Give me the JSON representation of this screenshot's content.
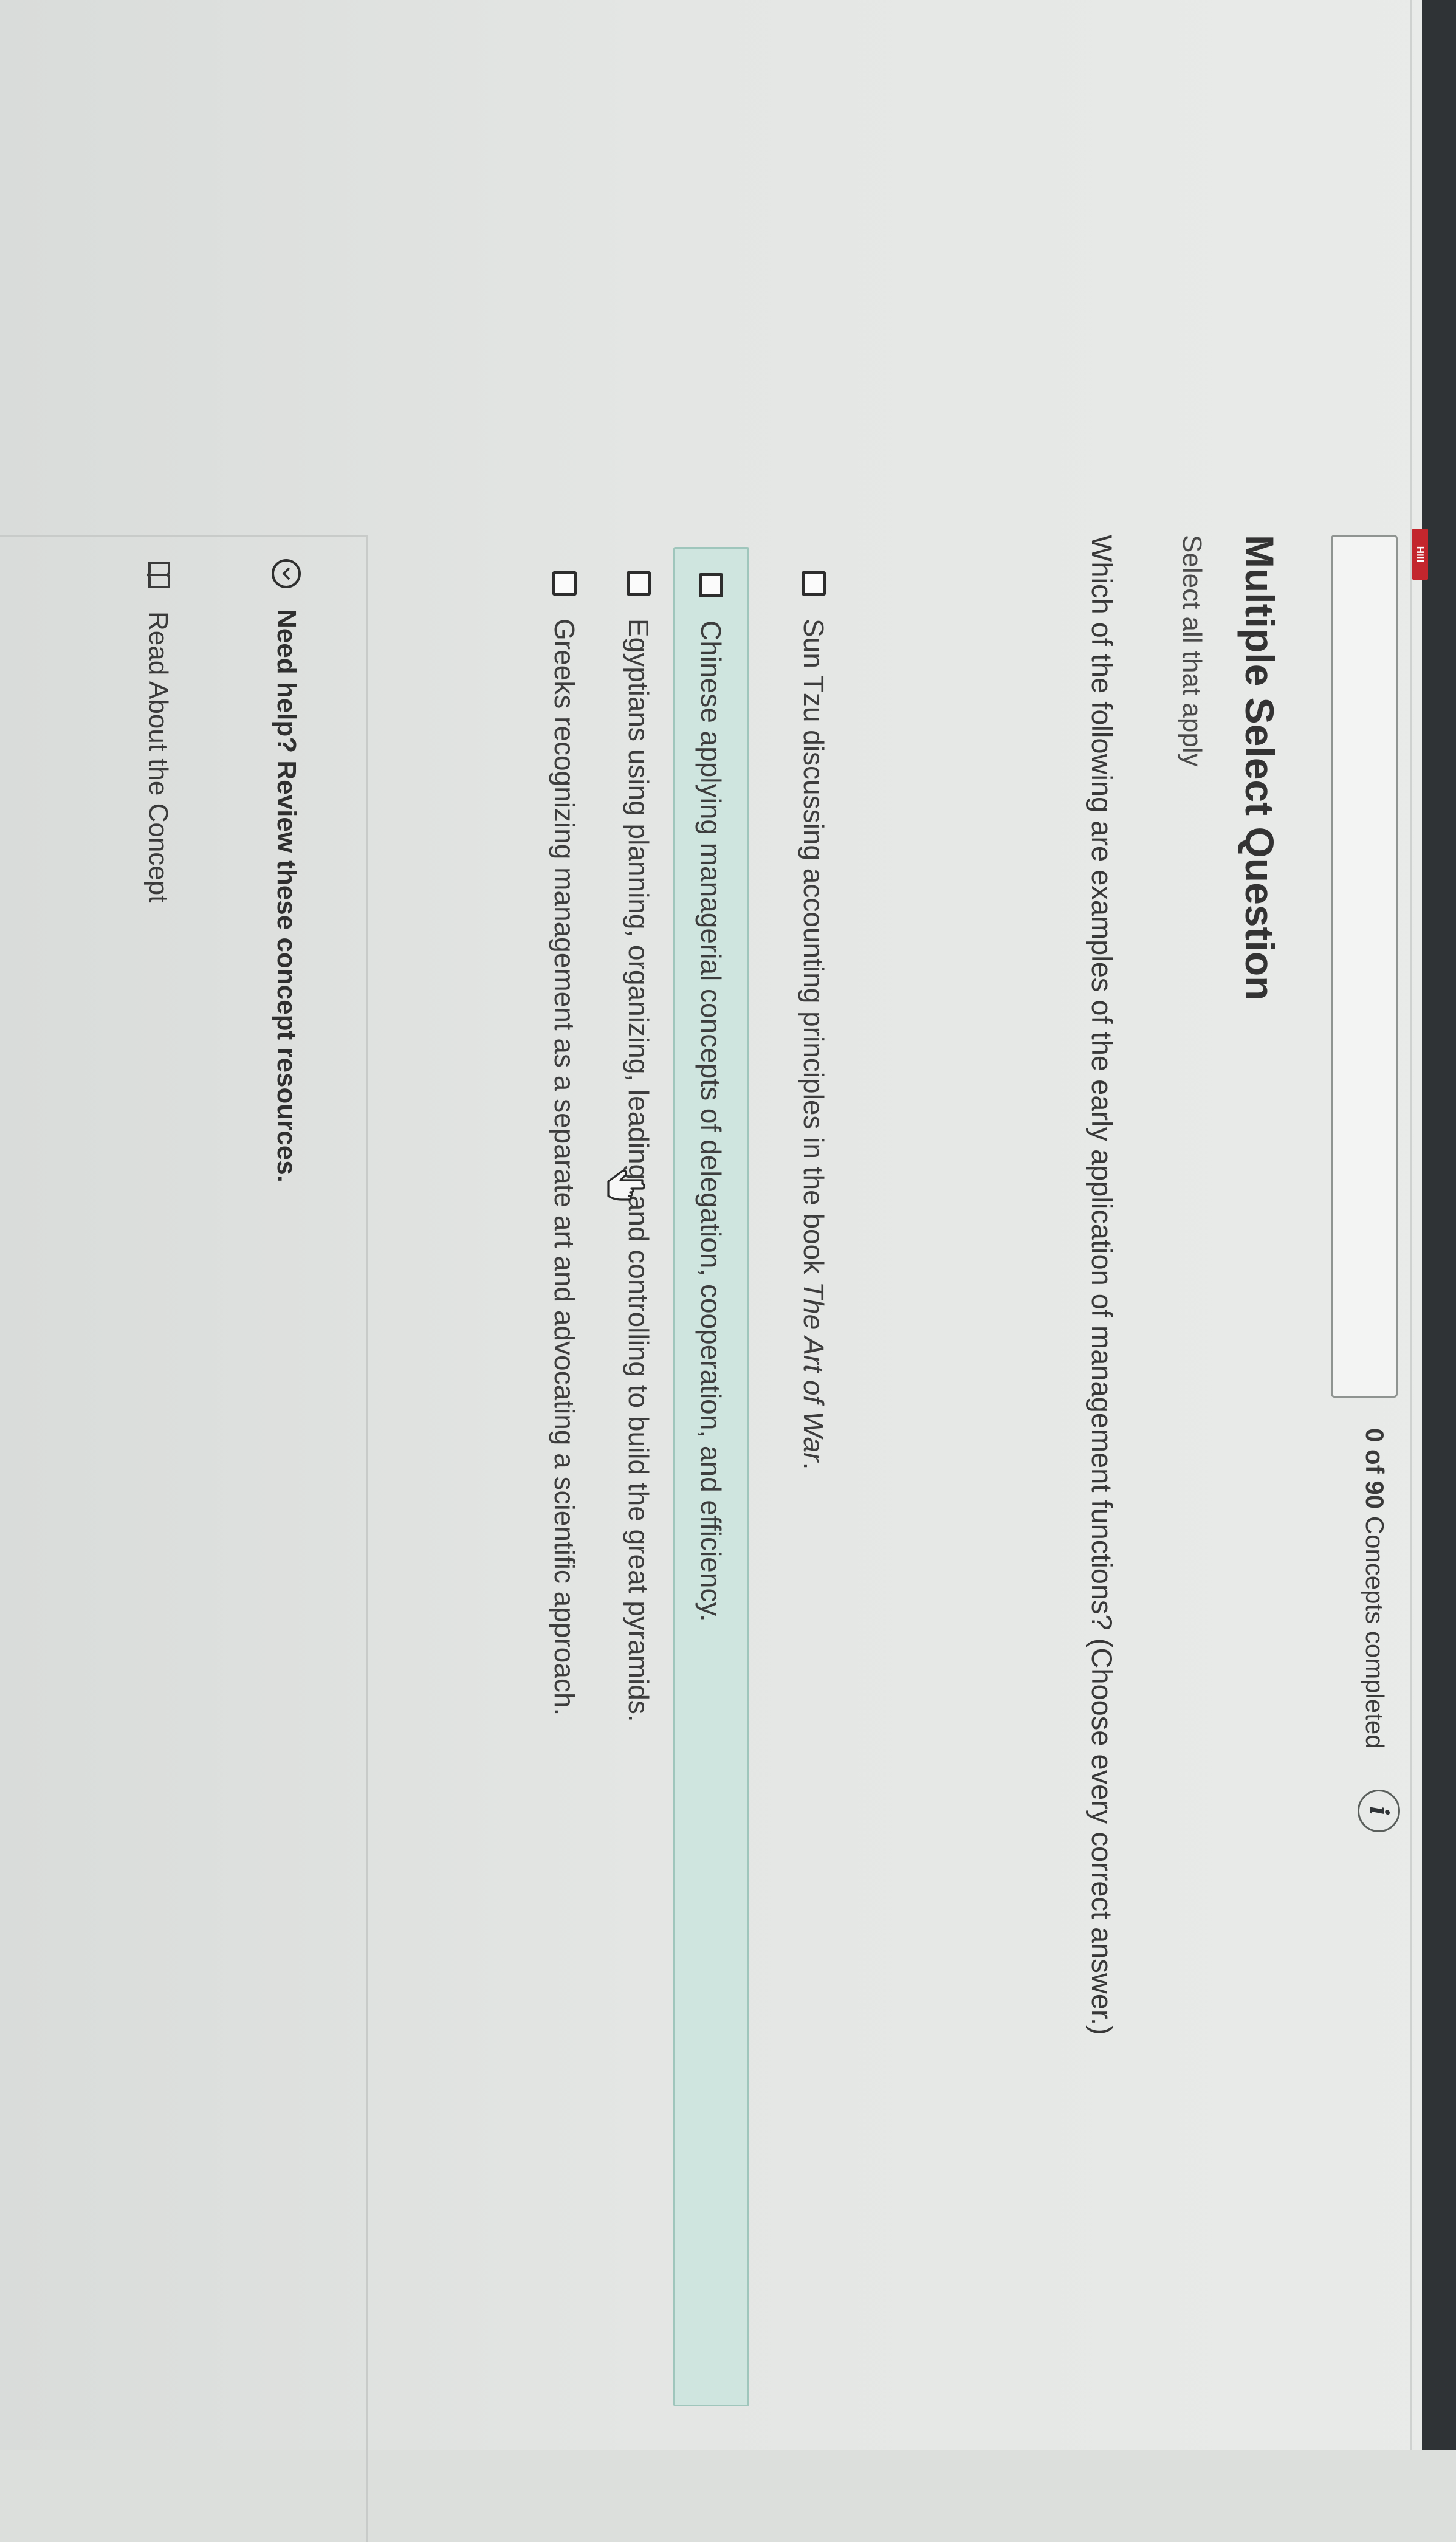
{
  "header": {
    "brand_logo": "Hill"
  },
  "progress": {
    "completed": 0,
    "total": 90,
    "count_text": "0 of 90",
    "label": "Concepts completed",
    "fraction": 0.0,
    "info_icon": "info-icon"
  },
  "question": {
    "type_title": "Multiple Select Question",
    "instruction": "Select all that apply",
    "prompt": "Which of the following are examples of the early application of management functions? (Choose every correct answer.)",
    "options": [
      {
        "text": "Sun Tzu discussing accounting principles in the book ",
        "emphasis": "The Art of War",
        "suffix": ".",
        "checked": false,
        "highlighted": false
      },
      {
        "text": "Chinese applying managerial concepts of delegation, cooperation, and efficiency.",
        "checked": false,
        "highlighted": true
      },
      {
        "text": "Egyptians using planning, organizing, leading, and controlling to build the great pyramids.",
        "checked": false,
        "highlighted": false
      },
      {
        "text": "Greeks recognizing management as a separate art and advocating a scientific approach.",
        "checked": false,
        "highlighted": false
      }
    ]
  },
  "help": {
    "toggle_label": "Need help? Review these concept resources.",
    "resources": [
      {
        "label": "Read About the Concept",
        "icon": "book-icon"
      }
    ]
  },
  "colors": {
    "highlight_bg": "#cfe5df",
    "brand_red": "#c3262d",
    "topbar": "#2f3336"
  }
}
